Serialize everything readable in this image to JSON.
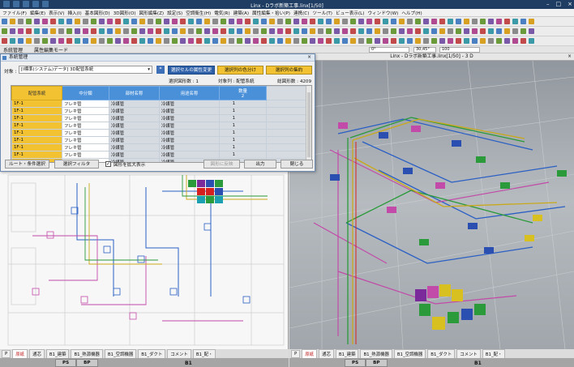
{
  "window": {
    "title": "Linx - Dラボ新築工事.linx[1/50]"
  },
  "menu": [
    "ファイル(F)",
    "編集(E)",
    "表示(V)",
    "挿入(I)",
    "基本図形(D)",
    "3D図形(O)",
    "図形編集(Z)",
    "設定(S)",
    "空調衛生(H)",
    "電気(R)",
    "建築(A)",
    "属性編集・拾い(P)",
    "連携(C)",
    "ツール(T)",
    "ビュー表示(L)",
    "ウィンドウ(W)",
    "ヘルプ(H)"
  ],
  "modebar": {
    "left_label": "系統管理",
    "mode_label": "属性編集モード",
    "angle_value": "0°",
    "rot_value": "30,45°",
    "zoom_value": "100"
  },
  "dialog": {
    "title": "系統管理",
    "target_label": "対象 :",
    "target_value": "[I標準(システム)データ] 3D配管系統",
    "btn_star": "*",
    "btn_selected_attr": "選択セルの属性変更",
    "btn_color_select": "選択列の色分け",
    "btn_aggregate": "選択列の集約",
    "info_selected": "選択図形数 : 1",
    "info_target": "対象列 : 配管系統",
    "info_total": "総図形数 : 4209",
    "columns": [
      "配管系統",
      "中分類",
      "部材名称",
      "用途名称",
      "数量"
    ],
    "qty_sub": "2",
    "rows": [
      [
        "1F-1",
        "フレキ管",
        "冷媒管",
        "冷媒管",
        "1"
      ],
      [
        "1F-1",
        "フレキ管",
        "冷媒管",
        "冷媒管",
        "1"
      ],
      [
        "1F-1",
        "フレキ管",
        "冷媒管",
        "冷媒管",
        "1"
      ],
      [
        "1F-1",
        "フレキ管",
        "冷媒管",
        "冷媒管",
        "1"
      ],
      [
        "1F-1",
        "フレキ管",
        "冷媒管",
        "冷媒管",
        "1"
      ],
      [
        "1F-1",
        "フレキ管",
        "冷媒管",
        "冷媒管",
        "1"
      ],
      [
        "1F-1",
        "フレキ管",
        "冷媒管",
        "冷媒管",
        "1"
      ],
      [
        "1F-1",
        "フレキ管",
        "冷媒管",
        "冷媒管",
        "1"
      ],
      [
        "1F-1",
        "フレキ管",
        "冷媒管",
        "冷媒管",
        "1"
      ]
    ],
    "btn_route": "ルート・条件選択",
    "btn_filter": "選択フィルタ",
    "chk_label": "図形を拡大表示",
    "btn_reflect": "図形に反映",
    "btn_output": "出力",
    "btn_close": "閉じる"
  },
  "view3d": {
    "title": "Linx - Dラボ新築工事.linx[1/50] - 3 D"
  },
  "tabs_left": [
    "原紙",
    "通芯",
    "B1_建築",
    "B1_熱源機器",
    "B1_空調機器",
    "B1_ダクト",
    "コメント",
    "B1_配・"
  ],
  "tabs_right": [
    "原紙",
    "通芯",
    "B1_建築",
    "B1_熱源機器",
    "B1_空調機器",
    "B1_ダクト",
    "コメント",
    "B1_配・"
  ],
  "subtabs": [
    "PS",
    "BP"
  ],
  "floor_label": "B1",
  "colors": {
    "accent_blue": "#2c5fa8",
    "header_blue": "#4a90d9",
    "yellow": "#f2c232"
  }
}
